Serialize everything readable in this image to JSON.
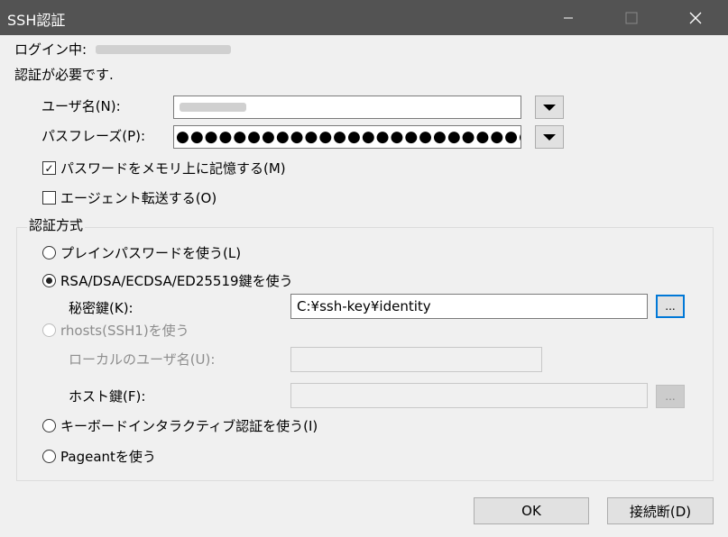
{
  "window": {
    "title": "SSH認証",
    "minimize_icon": "minimize-icon",
    "maximize_icon": "maximize-icon",
    "close_icon": "close-icon"
  },
  "header": {
    "login_label": "ログイン中:",
    "auth_required": "認証が必要です."
  },
  "username": {
    "label": "ユーザ名(N):",
    "value": ""
  },
  "passphrase": {
    "label": "パスフレーズ(P):",
    "value": "●●●●●●●●●●●●●●●●●●●●●●●●●●"
  },
  "options": {
    "remember_password": {
      "label": "パスワードをメモリ上に記憶する(M)",
      "checked": true,
      "check_glyph": "✓"
    },
    "agent_forward": {
      "label": "エージェント転送する(O)",
      "checked": false
    }
  },
  "auth_method": {
    "group_title": "認証方式",
    "plain_password": {
      "label": "プレインパスワードを使う(L)",
      "selected": false
    },
    "rsa_key": {
      "label": "RSA/DSA/ECDSA/ED25519鍵を使う",
      "selected": true
    },
    "private_key_label": "秘密鍵(K):",
    "private_key_value": "C:¥ssh-key¥identity",
    "browse_label": "...",
    "rhosts": {
      "label": "rhosts(SSH1)を使う",
      "enabled": false
    },
    "local_username_label": "ローカルのユーザ名(U):",
    "host_key_label": "ホスト鍵(F):",
    "keyboard_interactive": {
      "label": "キーボードインタラクティブ認証を使う(I)",
      "selected": false
    },
    "pageant": {
      "label": "Pageantを使う",
      "selected": false
    }
  },
  "buttons": {
    "ok": "OK",
    "disconnect": "接続断(D)"
  }
}
